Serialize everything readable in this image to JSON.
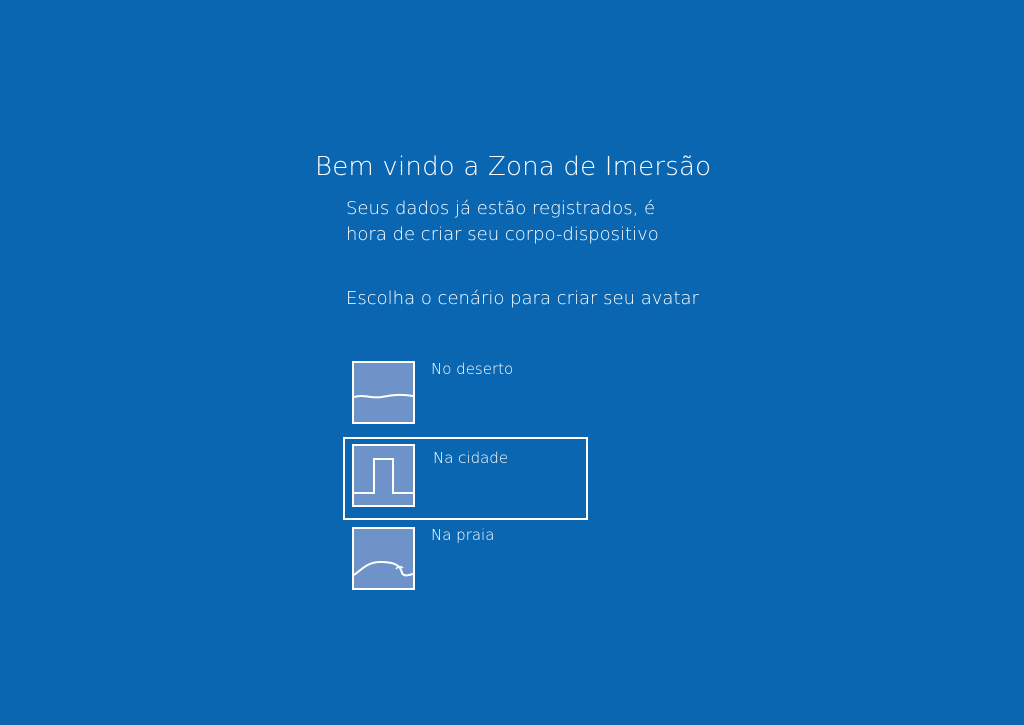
{
  "header": {
    "title": "Bem vindo a Zona de Imersão",
    "subtitle_line1": "Seus dados já estão registrados, é",
    "subtitle_line2": "hora de criar seu corpo-dispositivo"
  },
  "instruction": "Escolha o cenário para criar seu avatar",
  "options": [
    {
      "label": "No deserto",
      "icon": "desert-icon",
      "selected": false
    },
    {
      "label": "Na cidade",
      "icon": "city-icon",
      "selected": true
    },
    {
      "label": "Na praia",
      "icon": "beach-icon",
      "selected": false
    }
  ],
  "colors": {
    "background": "#0b66b2",
    "thumbnail_fill": "#6e93c8",
    "foreground": "#ffffff"
  }
}
